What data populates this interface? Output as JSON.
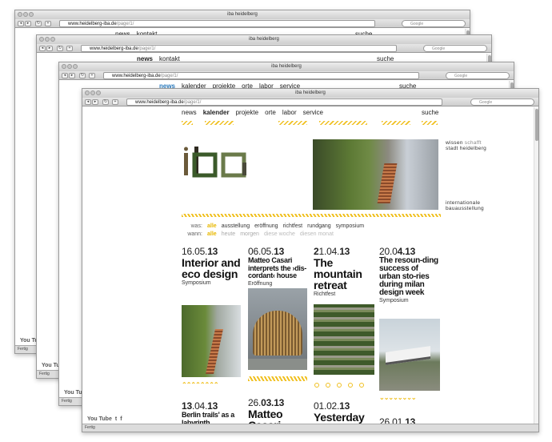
{
  "browser": {
    "title": "iba heidelberg",
    "url_host": "www.heidelberg-iba.de",
    "url_path": "/page/1/",
    "search_placeholder": "Google",
    "status": "Fertig",
    "back": "◂",
    "forward": "▸",
    "reload": "↻",
    "add": "+"
  },
  "nav": {
    "news": "news",
    "kontakt": "kontakt",
    "suche": "suche",
    "kalender": "kalender",
    "projekte": "projekte",
    "orte": "orte",
    "labor": "labor",
    "service": "service"
  },
  "tagline": {
    "wissen": "wissen",
    "schafft": "schafft",
    "stadt": "stadt heidelberg",
    "international_1": "internationale",
    "international_2": "bauausstellung"
  },
  "filter": {
    "was_label": "was:",
    "was_items": [
      "alle",
      "ausstellung",
      "eröffnung",
      "richtfest",
      "rundgang",
      "symposium"
    ],
    "wann_label": "wann:",
    "wann_items": [
      "alle",
      "heute",
      "morgen",
      "diese woche",
      "diesen monat"
    ]
  },
  "events": [
    {
      "day": "1",
      "date_rest": "6.05.",
      "year": "13",
      "title": "Interior and eco design",
      "type": "Symposium"
    },
    {
      "day": "06.05.",
      "date_rest": "",
      "year": "13",
      "title": "Matteo Casari interprets the ›dis-cordant‹ house",
      "type": "Eröffnung"
    },
    {
      "day": "2",
      "date_rest": "1.04.",
      "year": "13",
      "title": "The mountain retreat",
      "type": "Richtfest"
    },
    {
      "day": "20.0",
      "date_rest": "4.",
      "year": "13",
      "title": "The resoun-ding success of urban sto-ries during milan design week",
      "type": "Symposium"
    },
    {
      "day": "13",
      "date_rest": ".04.",
      "year": "13",
      "title": "Berlin trails' as a labyrinth",
      "type": ""
    },
    {
      "day": "26.",
      "date_rest": "03.",
      "year": "13",
      "title": "Matteo Casari",
      "type": ""
    },
    {
      "day": "01.02.",
      "date_rest": "",
      "year": "13",
      "title": "Yesterday",
      "type": ""
    },
    {
      "day": "26.",
      "date_rest": "01.",
      "year": "13",
      "title": "",
      "type": ""
    }
  ],
  "social": {
    "youtube": "You Tube",
    "twitter": "t",
    "facebook": "f"
  },
  "colors": {
    "accent": "#f0c020",
    "link_blue": "#2f7ec0"
  }
}
